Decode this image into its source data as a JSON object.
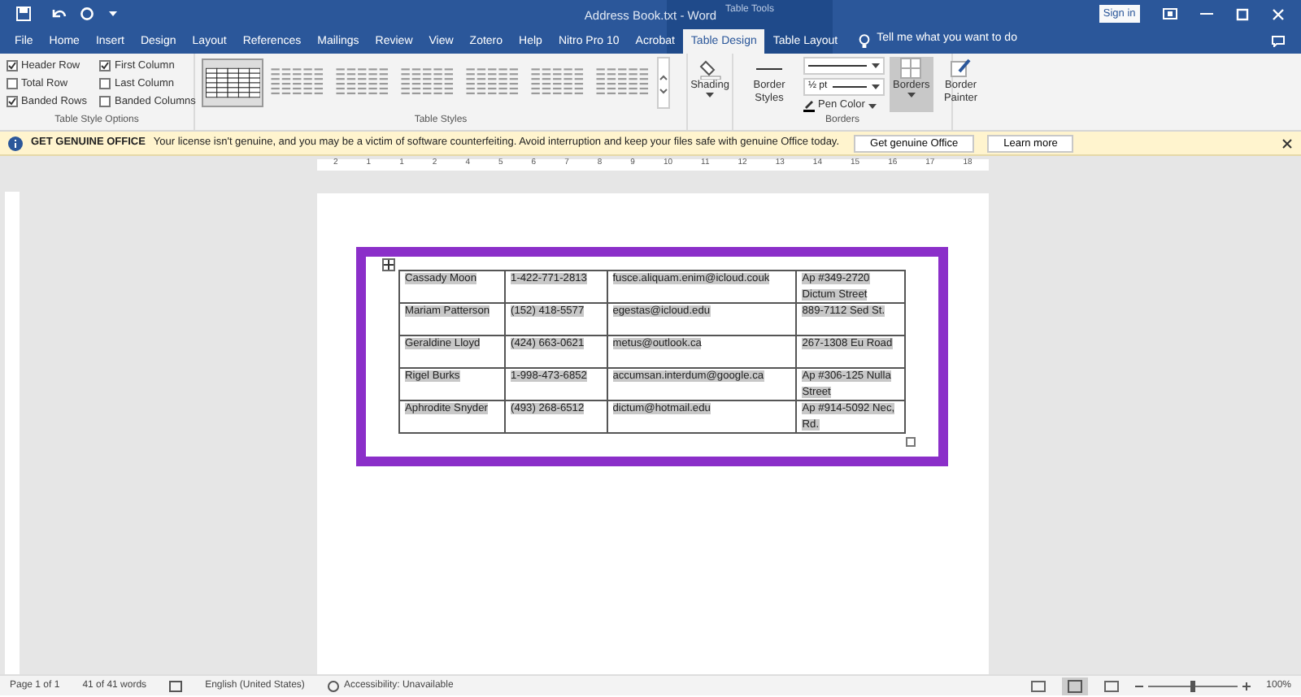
{
  "window": {
    "title": "Address Book.txt  -  Word",
    "context_title": "Table Tools",
    "sign_in": "Sign in"
  },
  "tabs": [
    {
      "label": "File",
      "selected": false
    },
    {
      "label": "Home",
      "selected": false
    },
    {
      "label": "Insert",
      "selected": false
    },
    {
      "label": "Design",
      "selected": false
    },
    {
      "label": "Layout",
      "selected": false
    },
    {
      "label": "References",
      "selected": false
    },
    {
      "label": "Mailings",
      "selected": false
    },
    {
      "label": "Review",
      "selected": false
    },
    {
      "label": "View",
      "selected": false
    },
    {
      "label": "Zotero",
      "selected": false
    },
    {
      "label": "Help",
      "selected": false
    },
    {
      "label": "Nitro Pro 10",
      "selected": false
    },
    {
      "label": "Acrobat",
      "selected": false
    },
    {
      "label": "Table Design",
      "selected": true
    },
    {
      "label": "Table Layout",
      "selected": false
    }
  ],
  "tell_me": "Tell me what you want to do",
  "style_options": {
    "label": "Table Style Options",
    "checks": [
      {
        "label": "Header Row",
        "checked": true
      },
      {
        "label": "Total Row",
        "checked": false
      },
      {
        "label": "Banded Rows",
        "checked": true
      },
      {
        "label": "First Column",
        "checked": true
      },
      {
        "label": "Last Column",
        "checked": false
      },
      {
        "label": "Banded Columns",
        "checked": false
      }
    ]
  },
  "table_styles": {
    "label": "Table Styles",
    "items": [
      {
        "selected": true
      },
      {
        "selected": false
      },
      {
        "selected": false
      },
      {
        "selected": false
      },
      {
        "selected": false
      },
      {
        "selected": false
      },
      {
        "selected": false
      }
    ]
  },
  "shading": "Shading",
  "borders": {
    "label": "Borders",
    "border_styles": "Border Styles",
    "weight": "½ pt",
    "pen_color": "Pen Color",
    "borders_button": "Borders",
    "borders_selected": true,
    "painter": "Border Painter"
  },
  "notice": {
    "title": "GET GENUINE OFFICE",
    "message": "Your license isn't genuine, and you may be a victim of software counterfeiting. Avoid interruption and keep your files safe with genuine Office today.",
    "buttons": [
      "Get genuine Office",
      "Learn more"
    ]
  },
  "ruler": [
    "2",
    "1",
    "1",
    "2",
    "4",
    "5",
    "6",
    "7",
    "8",
    "9",
    "10",
    "11",
    "12",
    "13",
    "14",
    "15",
    "16",
    "17",
    "18"
  ],
  "table": {
    "rows": [
      [
        "Cassady Moon",
        "1-422-771-2813",
        "fusce.aliquam.enim@icloud.couk",
        "Ap #349-2720 Dictum Street"
      ],
      [
        "Mariam Patterson",
        "(152) 418-5577",
        "egestas@icloud.edu",
        "889-7112 Sed St."
      ],
      [
        "Geraldine Lloyd",
        "(424) 663-0621",
        "metus@outlook.ca",
        "267-1308 Eu Road"
      ],
      [
        "Rigel Burks",
        "1-998-473-6852",
        "accumsan.interdum@google.ca",
        "Ap #306-125 Nulla Street"
      ],
      [
        "Aphrodite Snyder",
        "(493) 268-6512",
        "dictum@hotmail.edu",
        "Ap #914-5092 Nec, Rd."
      ]
    ]
  },
  "status_bar": {
    "page": "Page 1 of 1",
    "words": "41 of 41 words",
    "language": "English (United States)",
    "accessibility": "Accessibility: Unavailable",
    "zoom": "100%",
    "zoom_slider": {
      "level": 0.5
    }
  }
}
